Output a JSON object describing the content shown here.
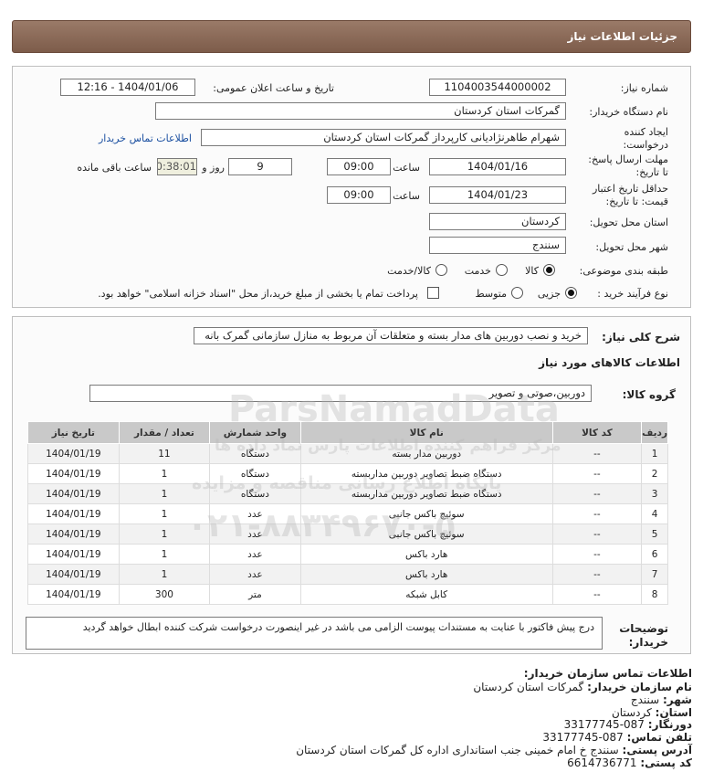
{
  "header": {
    "title": "جزئیات اطلاعات نیاز"
  },
  "form": {
    "need_number_label": "شماره نیاز:",
    "need_number": "1104003544000002",
    "announce_label": "تاریخ و ساعت اعلان عمومی:",
    "announce_value": "1404/01/06 - 12:16",
    "buyer_org_label": "نام دستگاه خریدار:",
    "buyer_org": "گمرکات استان کردستان",
    "creator_label_1": "ایجاد کننده",
    "creator_label_2": "درخواست:",
    "creator": "شهرام  طاهرنژادیانی کارپرداز گمرکات استان کردستان",
    "buyer_contact_link": "اطلاعات تماس خریدار",
    "deadline_label_1": "مهلت ارسال پاسخ:",
    "deadline_label_2": "تا تاریخ:",
    "deadline_date": "1404/01/16",
    "time_label": "ساعت",
    "deadline_time": "09:00",
    "days_remaining": "9",
    "days_label": "روز و",
    "remaining_time": "20:38:01",
    "remaining_label": "ساعت باقی مانده",
    "validity_label_1": "حداقل تاریخ اعتبار",
    "validity_label_2": "قیمت: تا تاریخ:",
    "validity_date": "1404/01/23",
    "validity_time_label": "ساعت",
    "validity_time": "09:00",
    "province_label": "استان محل تحویل:",
    "province": "کردستان",
    "city_label": "شهر محل تحویل:",
    "city": "سنندج",
    "category_label": "طبقه بندی موضوعی:",
    "category_options": [
      "کالا",
      "خدمت",
      "کالا/خدمت"
    ],
    "process_label": "نوع فرآیند خرید :",
    "process_options": [
      "جزیی",
      "متوسط"
    ],
    "payment_note": "پرداخت تمام یا بخشی از مبلغ خرید،از محل \"اسناد خزانه اسلامی\" خواهد بود."
  },
  "details": {
    "summary_label": "شرح کلی نیاز:",
    "summary": "خرید و نصب دوربین های مدار بسته و متعلقات آن مربوط به منازل سازمانی گمرک بانه",
    "goods_info_title": "اطلاعات کالاهای مورد نیاز",
    "goods_group_label": "گروه کالا:",
    "goods_group": "دوربین،صوتی و تصویر",
    "columns": [
      "ردیف",
      "کد کالا",
      "نام کالا",
      "واحد شمارش",
      "تعداد / مقدار",
      "تاریخ نیاز"
    ],
    "rows": [
      [
        "1",
        "--",
        "دوربین مدار بسته",
        "دستگاه",
        "11",
        "1404/01/19"
      ],
      [
        "2",
        "--",
        "دستگاه ضبط تصاویر دوربین مداربسته",
        "دستگاه",
        "1",
        "1404/01/19"
      ],
      [
        "3",
        "--",
        "دستگاه ضبط تصاویر دوربین مداربسته",
        "دستگاه",
        "1",
        "1404/01/19"
      ],
      [
        "4",
        "--",
        "سوئیچ باکس جانبی",
        "عدد",
        "1",
        "1404/01/19"
      ],
      [
        "5",
        "--",
        "سوئیچ باکس جانبی",
        "عدد",
        "1",
        "1404/01/19"
      ],
      [
        "6",
        "--",
        "هارد باکس",
        "عدد",
        "1",
        "1404/01/19"
      ],
      [
        "7",
        "--",
        "هارد باکس",
        "عدد",
        "1",
        "1404/01/19"
      ],
      [
        "8",
        "--",
        "کابل شبکه",
        "متر",
        "300",
        "1404/01/19"
      ]
    ],
    "notes_label_1": "توضیحات",
    "notes_label_2": "خریدار:",
    "notes": "درج پیش فاکتور با عنایت به مستندات پیوست الزامی می باشد در غیر اینصورت درخواست شرکت کننده ابطال خواهد گردید"
  },
  "contact": {
    "title": "اطلاعات تماس سازمان خریدار:",
    "org_label": "نام سازمان خریدار:",
    "org": "گمرکات استان کردستان",
    "city_label": "شهر:",
    "city": "سنندج",
    "province_label": "استان:",
    "province": "کردستان",
    "fax_label": "دورنگار:",
    "fax": "087-33177745",
    "phone_label": "تلفن تماس:",
    "phone": "087-33177745",
    "address_label": "آدرس پستی:",
    "address": "سنندج خ امام خمینی جنب استانداری اداره کل گمرکات استان کردستان",
    "postal_label": "کد پستی:",
    "postal": "6614736771"
  },
  "watermark": {
    "brand": "ParsNamadData",
    "line1": "مرکز فراهم کننده اطلاعات پارس نماد داده ها",
    "line2": "پایگاه اطلاع رسانی مناقصه و مزایده",
    "phone": "۰۲۱-۸۸۳۴۹۶۷۰-۵"
  },
  "colors": {
    "header_bg": "#8a6a58",
    "link": "#1a4fa0",
    "table_header": "#c9c9c9"
  }
}
